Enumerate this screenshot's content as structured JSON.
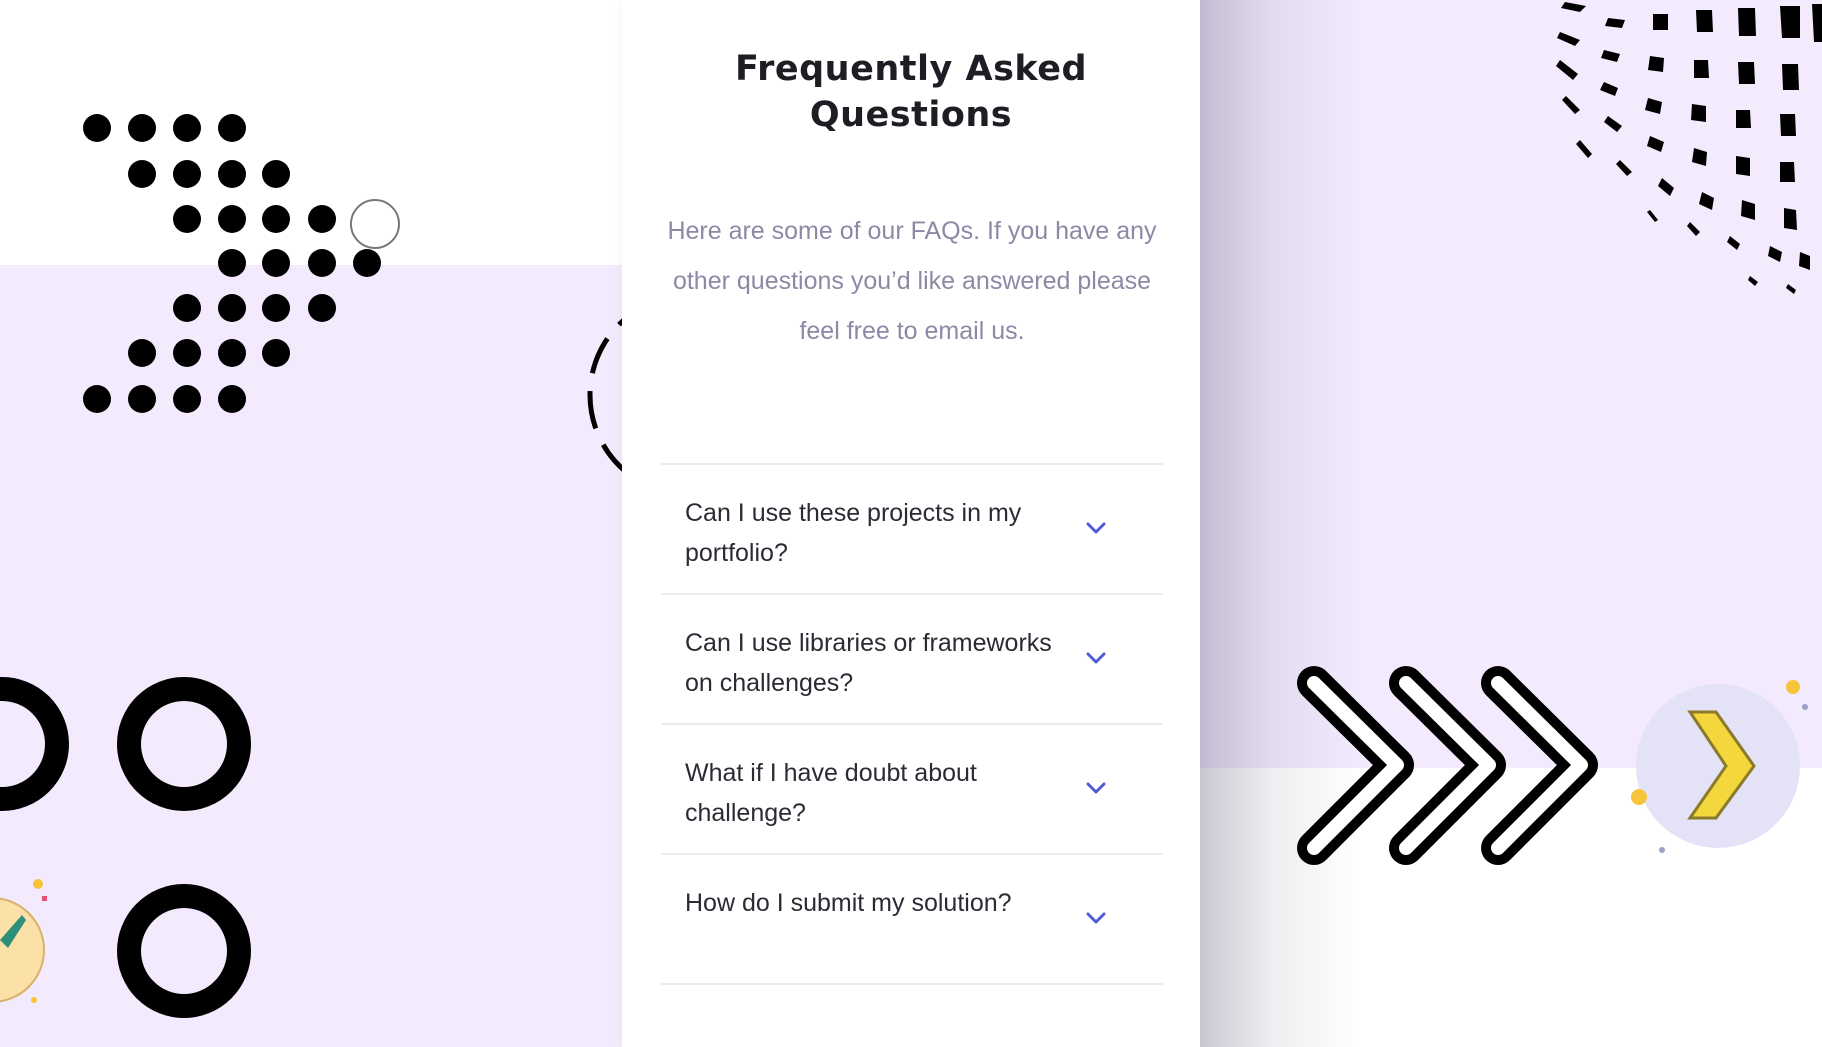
{
  "faq": {
    "title_line1": "Frequently Asked",
    "title_line2": "Questions",
    "intro": "Here are some of our FAQs. If you have any other questions you’d like answered please feel free to email us.",
    "items": [
      {
        "question": "Can I use these projects in my portfolio?",
        "icon": "chevron-down-icon"
      },
      {
        "question": "Can I use libraries or frameworks on challenges?",
        "icon": "chevron-down-icon"
      },
      {
        "question": "What if I have doubt about challenge?",
        "icon": "chevron-down-icon"
      },
      {
        "question": "How do I submit my solution?",
        "icon": "chevron-down-icon"
      }
    ]
  },
  "colors": {
    "accent": "#4f5bd5",
    "background_tint": "#f3eafd",
    "title": "#1d1d24",
    "muted_text": "#8b8aa6",
    "question_text": "#2b2b36"
  },
  "decorations": [
    "dot-arrow-pattern",
    "dashed-circle-outline",
    "ring-shapes",
    "ticket-icon",
    "perspective-grid-pattern",
    "triple-chevron-arrows",
    "yellow-chevron-badge"
  ]
}
